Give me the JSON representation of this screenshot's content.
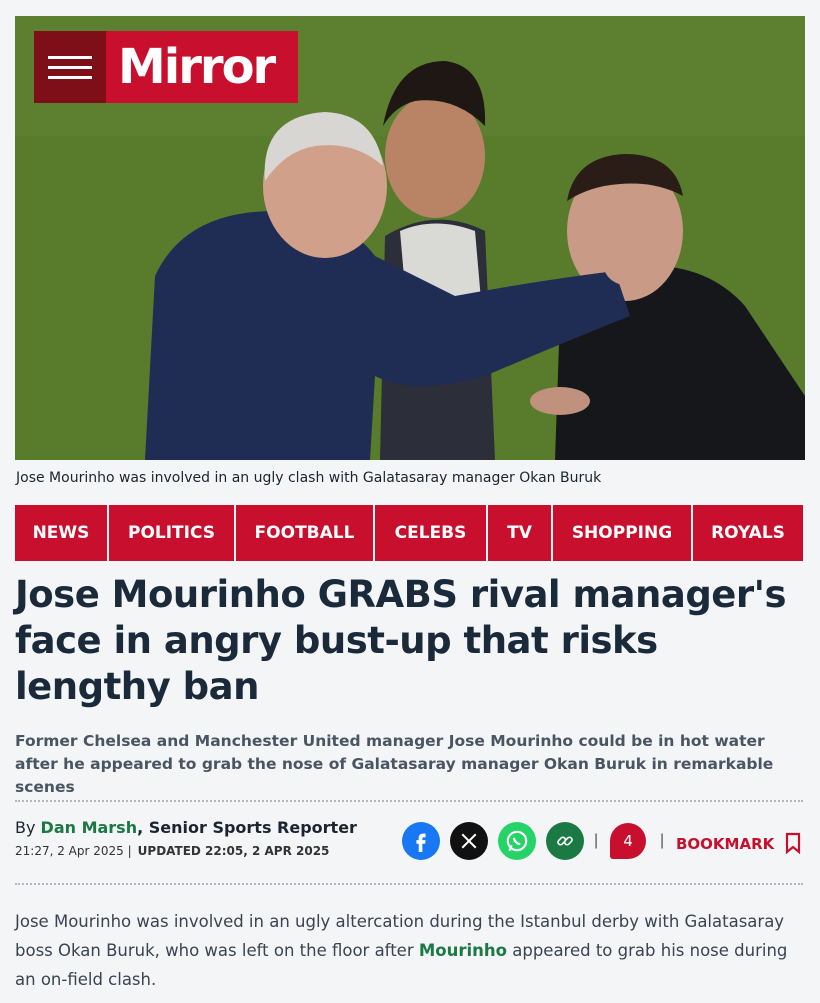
{
  "brand": {
    "logo_text": "Mirror"
  },
  "hero": {
    "caption": "Jose Mourinho was involved in an ugly clash with Galatasaray manager Okan Buruk"
  },
  "nav": {
    "items": [
      "NEWS",
      "POLITICS",
      "FOOTBALL",
      "CELEBS",
      "TV",
      "SHOPPING",
      "ROYALS"
    ]
  },
  "article": {
    "headline": "Jose Mourinho GRABS rival manager's face in angry bust-up that risks lengthy ban",
    "standfirst": "Former Chelsea and Manchester United manager Jose Mourinho could be in hot water after he appeared to grab the nose of Galatasaray manager Okan Buruk in remarkable scenes",
    "byline": {
      "prefix": "By ",
      "author": "Dan Marsh",
      "role": ", Senior Sports Reporter"
    },
    "published": "21:27, 2 Apr 2025",
    "updated": "UPDATED 22:05, 2 APR 2025",
    "body_before": "Jose Mourinho was involved in an ugly altercation during the Istanbul derby with Galatasaray boss Okan Buruk, who was left on the floor after ",
    "body_link": "Mourinho",
    "body_after": " appeared to grab his nose during an on-field clash."
  },
  "share": {
    "icons": [
      "facebook-icon",
      "x-icon",
      "whatsapp-icon",
      "link-icon"
    ],
    "comment_count": "4",
    "bookmark_label": "BOOKMARK"
  },
  "colors": {
    "brand_red": "#c8102e",
    "link_green": "#1b7a44",
    "facebook": "#1877f2",
    "whatsapp": "#25d366",
    "headline": "#1b2a3a"
  }
}
